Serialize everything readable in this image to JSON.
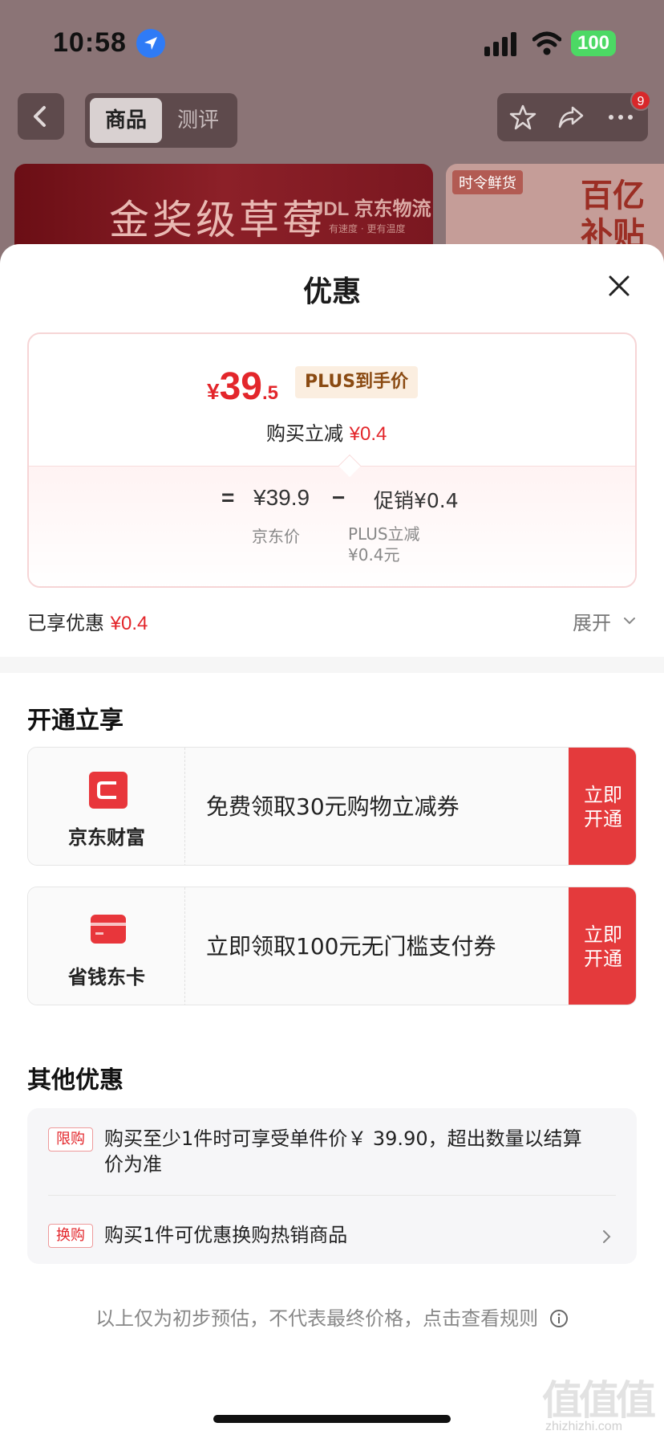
{
  "status_bar": {
    "time": "10:58",
    "battery": "100",
    "icons": [
      "location-icon",
      "signal-icon",
      "wifi-icon",
      "battery-icon"
    ]
  },
  "nav": {
    "tabs": [
      "商品",
      "测评"
    ],
    "active_tab": "商品",
    "badge_count": "9",
    "icons": [
      "back-icon",
      "star-icon",
      "share-icon",
      "more-icon"
    ]
  },
  "banners": {
    "left_title": "金奖级草莓",
    "left_logo": "JDL 京东物流",
    "left_sub": "有速度 · 更有温度",
    "right_tag": "时令鲜货",
    "right_title": "百亿补贴"
  },
  "sheet": {
    "title": "优惠",
    "price": {
      "currency": "¥",
      "integer": "39",
      "decimal": ".5",
      "plus_tag": "PLUS到手价",
      "direct_label": "购买立减 ",
      "direct_value": "¥0.4",
      "formula_eq": "=",
      "jd_price": "¥39.9",
      "minus": "−",
      "promo": "促销¥0.4",
      "jd_price_caption": "京东价",
      "plus_caption_line1": "PLUS立减",
      "plus_caption_line2": "¥0.4元"
    },
    "enjoyed_label": "已享优惠 ",
    "enjoyed_value": "¥0.4",
    "expand_label": "展开",
    "open_section": {
      "title": "开通立享",
      "cards": [
        {
          "brand": "京东财富",
          "text": "免费领取30元购物立减券",
          "button_line1": "立即",
          "button_line2": "开通"
        },
        {
          "brand": "省钱东卡",
          "text": "立即领取100元无门槛支付券",
          "button_line1": "立即",
          "button_line2": "开通"
        }
      ]
    },
    "other_section": {
      "title": "其他优惠",
      "items": [
        {
          "tag": "限购",
          "text_line1": "购买至少1件时可享受单件价￥ 39.90，超出数量以结算",
          "text_line2": "价为准"
        },
        {
          "tag": "换购",
          "text_line1": "购买1件可优惠换购热销商品"
        }
      ]
    },
    "disclaimer": "以上仅为初步预估，不代表最终价格，点击查看规则"
  },
  "watermark": {
    "main": "值值值",
    "sub": "zhizhizhi.com"
  },
  "colors": {
    "accent_red": "#e3262b",
    "button_red": "#e43a3c",
    "plus_tag_bg": "#fbeee0"
  }
}
